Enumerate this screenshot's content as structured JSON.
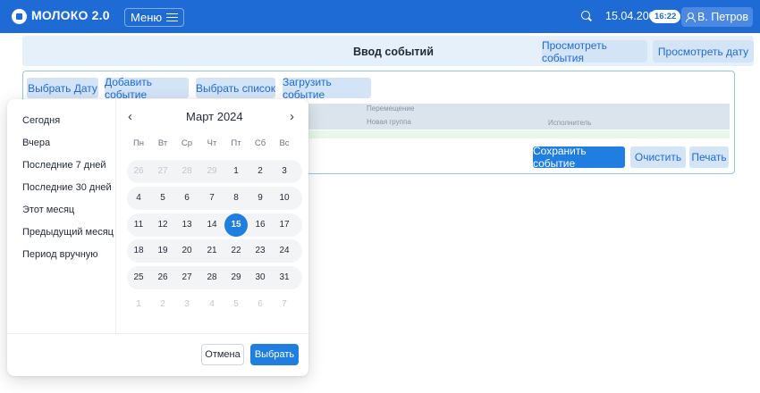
{
  "app": {
    "brand": "МОЛОКО 2.0",
    "menu_label": "Меню",
    "date": "15.04.2004",
    "time": "16:22",
    "user": "В. Петров"
  },
  "header": {
    "title": "Ввод событий",
    "view_events_label": "Просмотреть события",
    "view_date_label": "Просмотреть дату"
  },
  "toolbar": {
    "pick_date": "Выбрать Дату",
    "add_event": "Добавить событие",
    "pick_list": "Выбрать список",
    "load_event": "Загрузить событие"
  },
  "table": {
    "col_move": "Перемещение",
    "col_group": "Новая группа",
    "col_executor": "Исполнитель"
  },
  "actions": {
    "save": "Сохранить событие",
    "clear": "Очистить",
    "print": "Печать"
  },
  "datepicker": {
    "presets": [
      "Сегодня",
      "Вчера",
      "Последние 7 дней",
      "Последние 30 дней",
      "Этот месяц",
      "Предыдущий месяц",
      "Период вручную"
    ],
    "month_title": "Март 2024",
    "weekdays": [
      "Пн",
      "Вт",
      "Ср",
      "Чт",
      "Пт",
      "Сб",
      "Вс"
    ],
    "weeks": [
      [
        "26",
        "27",
        "28",
        "29",
        "1",
        "2",
        "3"
      ],
      [
        "4",
        "5",
        "6",
        "7",
        "8",
        "9",
        "10"
      ],
      [
        "11",
        "12",
        "13",
        "14",
        "15",
        "16",
        "17"
      ],
      [
        "18",
        "19",
        "20",
        "21",
        "22",
        "23",
        "24"
      ],
      [
        "25",
        "26",
        "27",
        "28",
        "29",
        "30",
        "31"
      ],
      [
        "1",
        "2",
        "3",
        "4",
        "5",
        "6",
        "7"
      ]
    ],
    "selected_day": "15",
    "cancel": "Отмена",
    "choose": "Выбрать"
  },
  "colors": {
    "topbar": "#1f6bd6",
    "accent": "#1f7ee0",
    "soft_button": "#d4e4f7"
  }
}
